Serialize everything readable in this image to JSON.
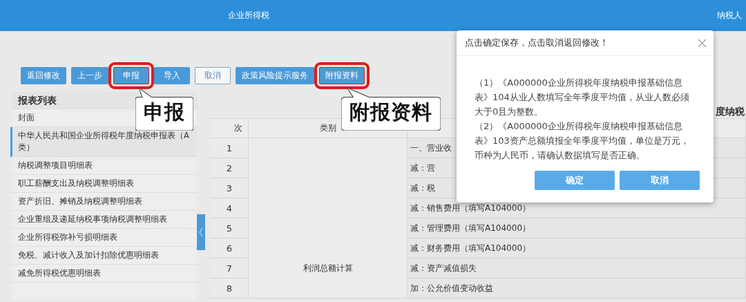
{
  "header": {
    "title": "企业所得税",
    "right_text": "纳税人"
  },
  "toolbar": [
    {
      "label": "返回修改",
      "kind": "primary",
      "highlighted": false
    },
    {
      "label": "上一步",
      "kind": "primary",
      "highlighted": false
    },
    {
      "label": "申报",
      "kind": "primary",
      "highlighted": true,
      "callout": "申报"
    },
    {
      "label": "导入",
      "kind": "primary",
      "highlighted": false
    },
    {
      "label": "取消",
      "kind": "outline",
      "highlighted": false
    },
    {
      "label": "政策风险提示服务",
      "kind": "primary",
      "highlighted": false
    },
    {
      "label": "附报资料",
      "kind": "primary",
      "highlighted": true,
      "callout": "附报资料"
    }
  ],
  "sidebar": {
    "title": "报表列表",
    "items": [
      {
        "label": "封面",
        "selected": false
      },
      {
        "label": "中华人民共和国企业所得税年度纳税申报表（A类）",
        "selected": true
      },
      {
        "label": "纳税调整项目明细表",
        "selected": false
      },
      {
        "label": "职工薪酬支出及纳税调整明细表",
        "selected": false
      },
      {
        "label": "资产折旧、摊销及纳税调整明细表",
        "selected": false
      },
      {
        "label": "企业重组及递延纳税事项纳税调整明细表",
        "selected": false
      },
      {
        "label": "企业所得税弥补亏损明细表",
        "selected": false
      },
      {
        "label": "免税、减计收入及加计扣除优惠明细表",
        "selected": false
      },
      {
        "label": "减免所得税优惠明细表",
        "selected": false
      }
    ]
  },
  "table": {
    "title": "度纳税",
    "columns": [
      "次",
      "类别"
    ],
    "category": "利润总额计算",
    "rows": [
      {
        "no": "1",
        "item": "一、营业收"
      },
      {
        "no": "2",
        "item": "减：营"
      },
      {
        "no": "3",
        "item": "减：税"
      },
      {
        "no": "4",
        "item": "减：销售费用（填写A104000）"
      },
      {
        "no": "5",
        "item": "减：管理费用（填写A104000）"
      },
      {
        "no": "6",
        "item": "减：财务费用（填写A104000）"
      },
      {
        "no": "7",
        "item": "减：资产减值损失"
      },
      {
        "no": "8",
        "item": "加：公允价值变动收益"
      }
    ]
  },
  "dialog": {
    "title": "点击确定保存，点击取消返回修改！",
    "paragraphs": [
      "（1）《A000000企业所得税年度纳税申报基础信息表》104从业人数填写全年季度平均值，从业人数必须大于0且为整数。",
      "（2）《A000000企业所得税年度纳税申报基础信息表》103资产总额填报全年季度平均值，单位是万元，币种为人民币，请确认数据填写是否正确。"
    ],
    "buttons": [
      "确定",
      "取消"
    ]
  }
}
